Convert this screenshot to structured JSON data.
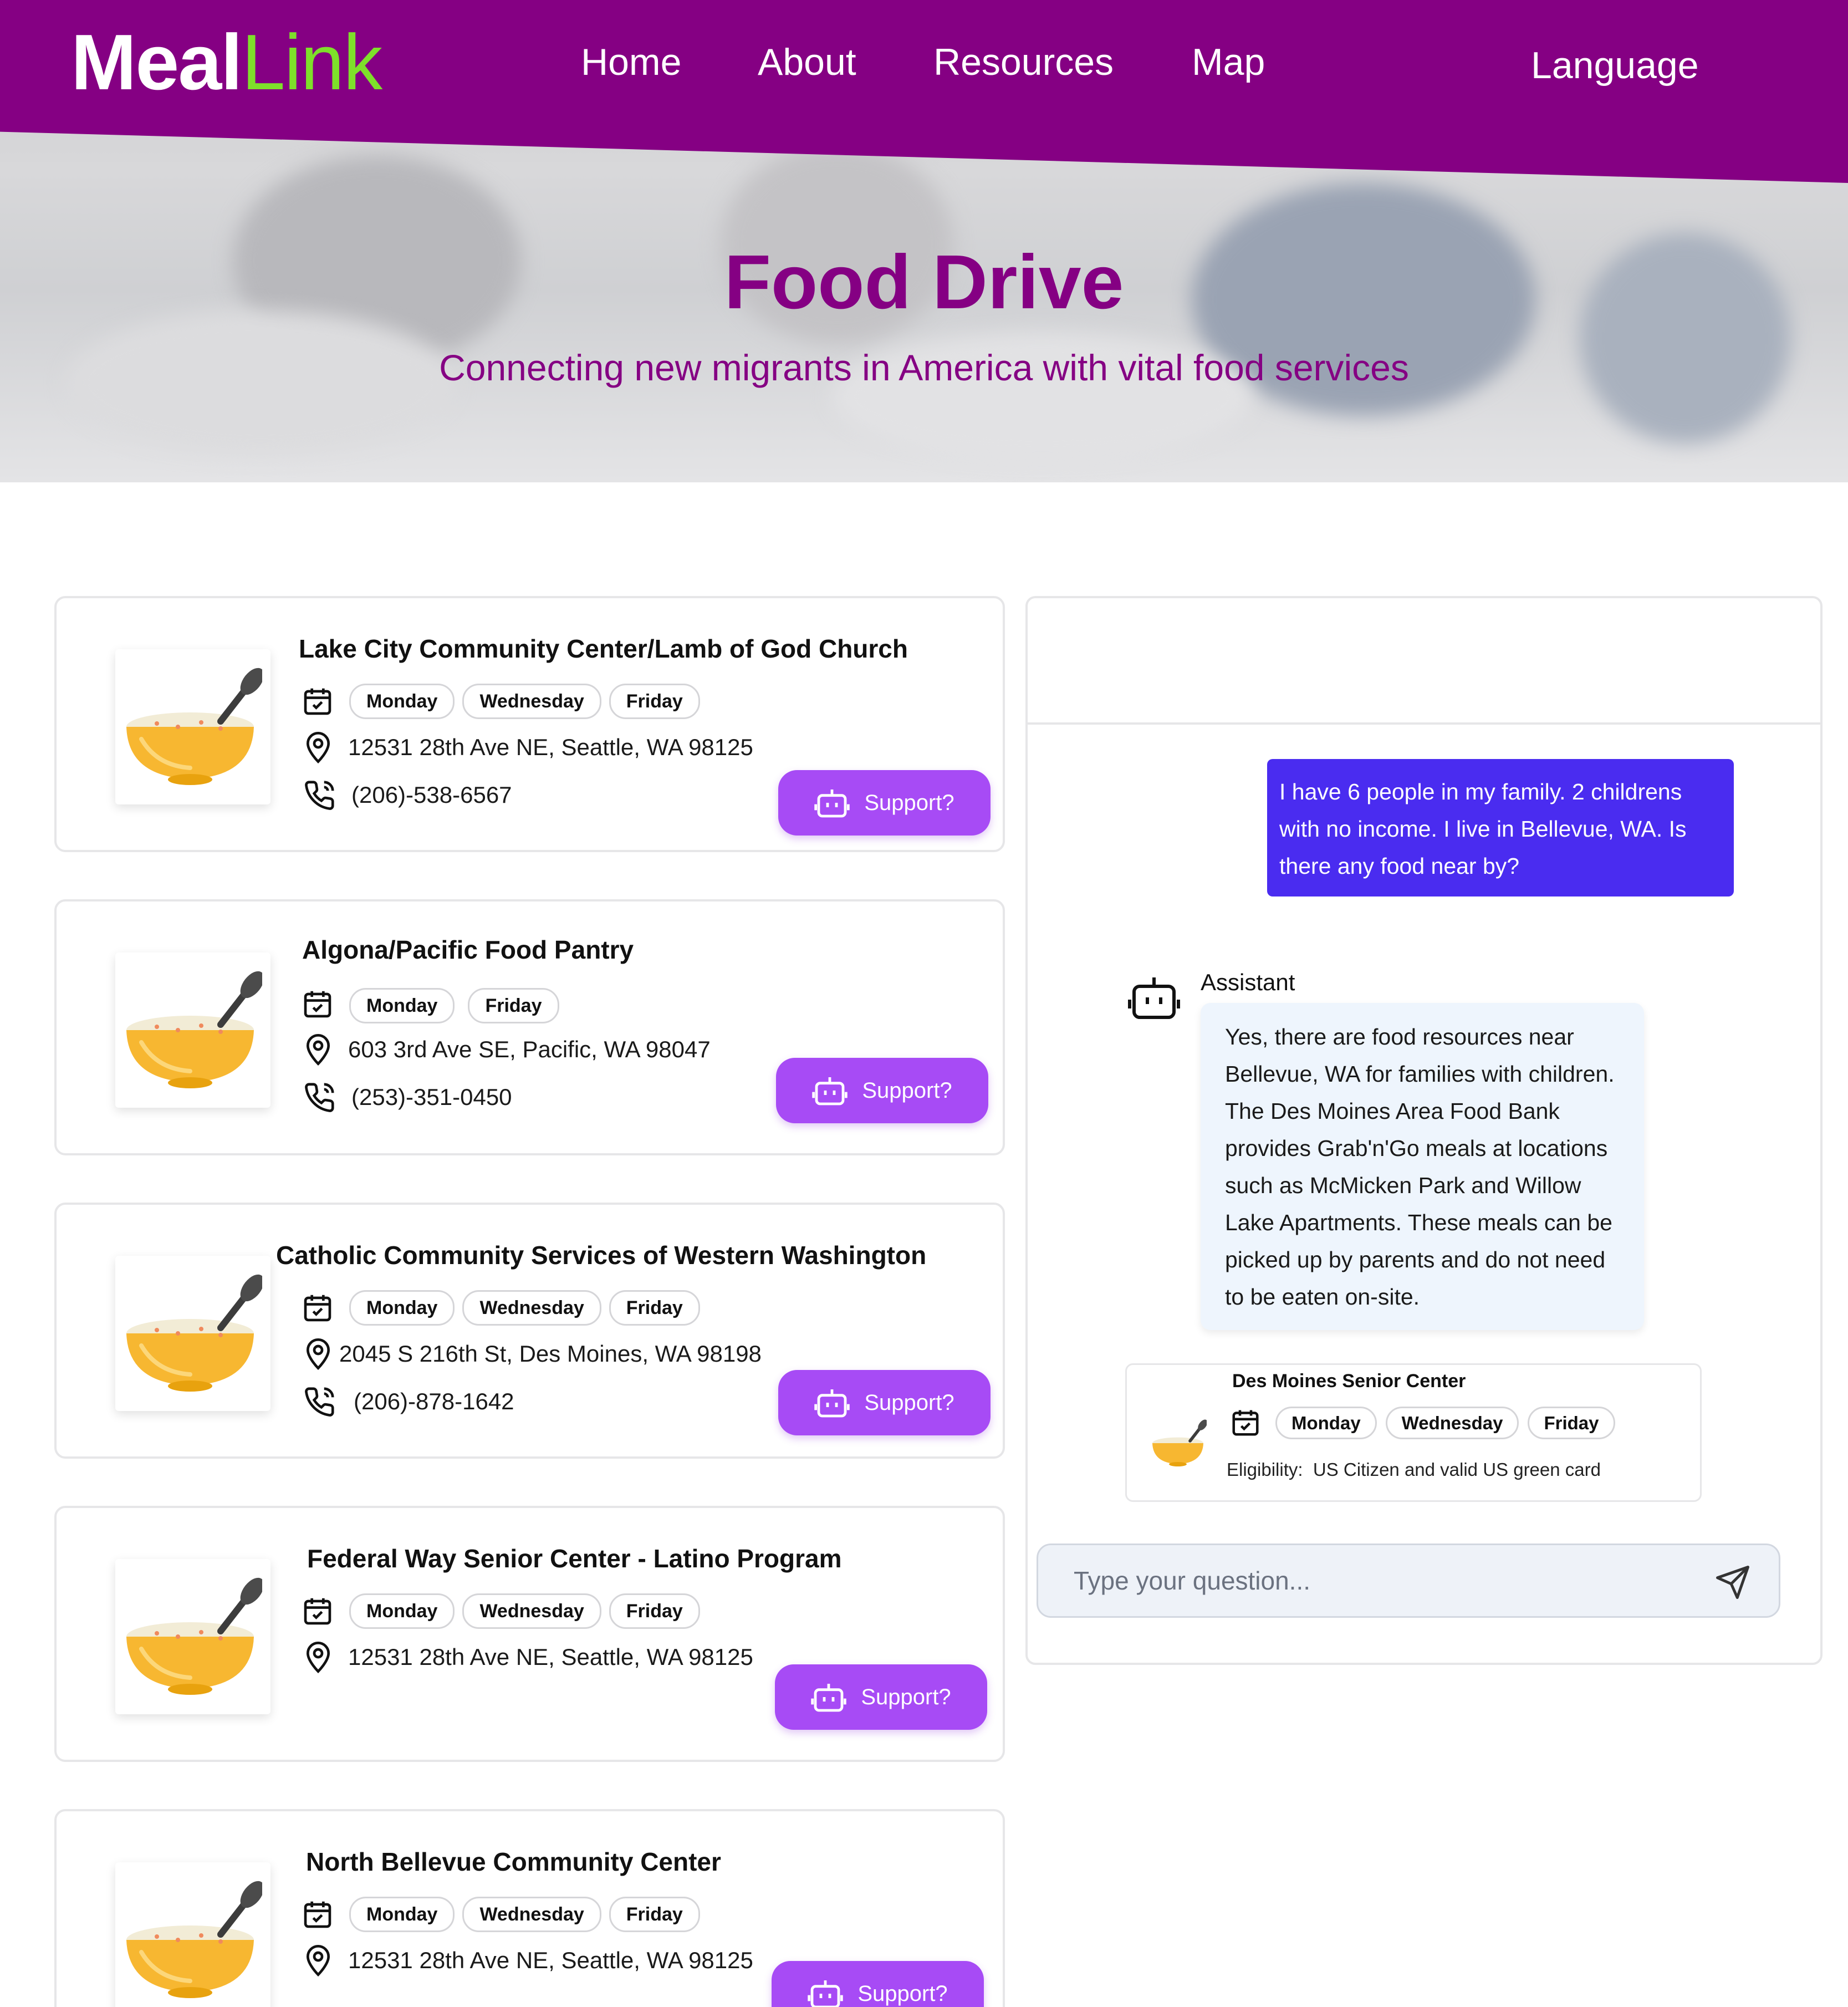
{
  "brand": {
    "part1": "Meal",
    "part2": "Link"
  },
  "nav": {
    "home": "Home",
    "about": "About",
    "resources": "Resources",
    "map": "Map",
    "language": "Language"
  },
  "hero": {
    "title": "Food Drive",
    "subtitle": "Connecting new migrants in America with vital food services"
  },
  "colors": {
    "brand_purple": "#850083",
    "logo_green": "#7ee02a",
    "button_purple": "#a74bf5",
    "user_bubble": "#4a2cf0",
    "assistant_bubble": "#eef5fd"
  },
  "listings": [
    {
      "name": "Lake City Community Center/Lamb of God Church",
      "days": [
        "Monday",
        "Wednesday",
        "Friday"
      ],
      "address": "12531 28th Ave NE, Seattle, WA 98125",
      "phone": "(206)-538-6567",
      "action": "Support?"
    },
    {
      "name": "Algona/Pacific Food Pantry",
      "days": [
        "Monday",
        "Friday"
      ],
      "address": "603 3rd Ave SE, Pacific, WA 98047",
      "phone": "(253)-351-0450",
      "action": "Support?"
    },
    {
      "name": "Catholic Community Services of Western Washington",
      "days": [
        "Monday",
        "Wednesday",
        "Friday"
      ],
      "address": "2045 S 216th St, Des Moines, WA 98198",
      "phone": "(206)-878-1642",
      "action": "Support?"
    },
    {
      "name": "Federal Way Senior Center -  Latino Program",
      "days": [
        "Monday",
        "Wednesday",
        "Friday"
      ],
      "address": "12531 28th Ave NE, Seattle, WA 98125",
      "action": "Support?"
    },
    {
      "name": "North Bellevue Community Center",
      "days": [
        "Monday",
        "Wednesday",
        "Friday"
      ],
      "address": "12531 28th Ave NE, Seattle, WA 98125",
      "action": "Support?"
    }
  ],
  "chat": {
    "user_message": "I have 6 people in my family. 2 childrens with no income. I live in Bellevue, WA. Is there any food near by?",
    "assistant_label": "Assistant",
    "assistant_message": "Yes, there are food resources near Bellevue, WA for families with children. The Des Moines Area Food Bank provides Grab'n'Go meals at locations such as McMicken Park and Willow Lake Apartments. These meals can be picked up by parents and do not need to be eaten on-site.",
    "suggestion": {
      "name": "Des Moines Senior Center",
      "days": [
        "Monday",
        "Wednesday",
        "Friday"
      ],
      "eligibility_label": "Eligibility:",
      "eligibility": "US Citizen and valid US green card"
    },
    "input_placeholder": "Type your question...",
    "input_value": ""
  },
  "icons": {
    "calendar": "calendar-check-icon",
    "location": "map-pin-icon",
    "phone": "phone-call-icon",
    "bot": "robot-icon",
    "send": "send-icon",
    "bowl": "soup-bowl-icon"
  }
}
